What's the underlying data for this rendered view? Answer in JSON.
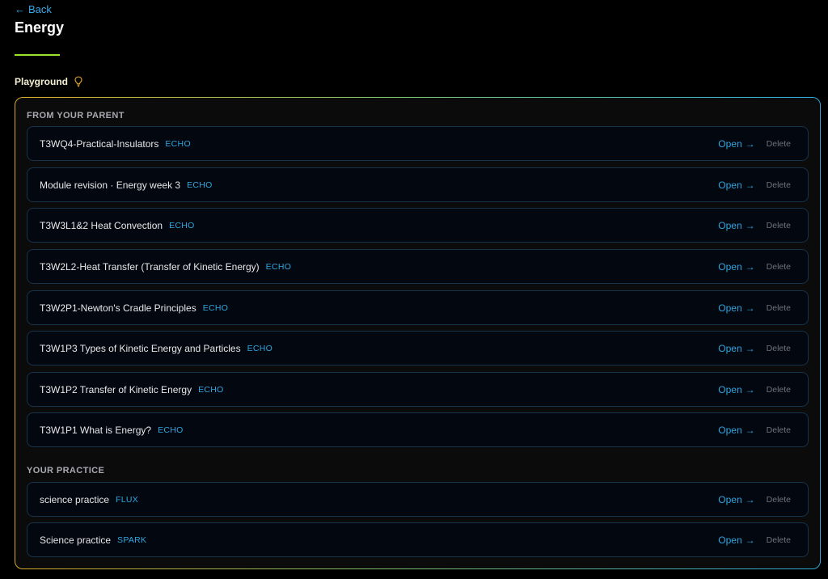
{
  "header": {
    "back_arrow": "←",
    "back_label": "Back",
    "title": "Energy",
    "accent_color": "#9be22f"
  },
  "playground": {
    "label": "Playground",
    "icon": "lightbulb-icon"
  },
  "sections": {
    "parent": {
      "heading": "FROM YOUR PARENT",
      "items": [
        {
          "title": "T3WQ4-Practical-Insulators",
          "tag": "ECHO",
          "open": "Open",
          "open_arrow": "→",
          "delete": "Delete"
        },
        {
          "title": "Module revision · Energy week 3",
          "tag": "ECHO",
          "open": "Open",
          "open_arrow": "→",
          "delete": "Delete"
        },
        {
          "title": "T3W3L1&2 Heat Convection",
          "tag": "ECHO",
          "open": "Open",
          "open_arrow": "→",
          "delete": "Delete"
        },
        {
          "title": "T3W2L2-Heat Transfer (Transfer of Kinetic Energy)",
          "tag": "ECHO",
          "open": "Open",
          "open_arrow": "→",
          "delete": "Delete"
        },
        {
          "title": "T3W2P1-Newton's Cradle Principles",
          "tag": "ECHO",
          "open": "Open",
          "open_arrow": "→",
          "delete": "Delete"
        },
        {
          "title": "T3W1P3 Types of Kinetic Energy and Particles",
          "tag": "ECHO",
          "open": "Open",
          "open_arrow": "→",
          "delete": "Delete"
        },
        {
          "title": "T3W1P2 Transfer of Kinetic Energy",
          "tag": "ECHO",
          "open": "Open",
          "open_arrow": "→",
          "delete": "Delete"
        },
        {
          "title": "T3W1P1 What is Energy?",
          "tag": "ECHO",
          "open": "Open",
          "open_arrow": "→",
          "delete": "Delete"
        }
      ]
    },
    "practice": {
      "heading": "YOUR PRACTICE",
      "items": [
        {
          "title": "science practice",
          "tag": "FLUX",
          "open": "Open",
          "open_arrow": "→",
          "delete": "Delete"
        },
        {
          "title": "Science practice",
          "tag": "SPARK",
          "open": "Open",
          "open_arrow": "→",
          "delete": "Delete"
        }
      ]
    }
  },
  "colors": {
    "link": "#2fa6e0",
    "row_border": "#173349",
    "background": "#000000"
  }
}
